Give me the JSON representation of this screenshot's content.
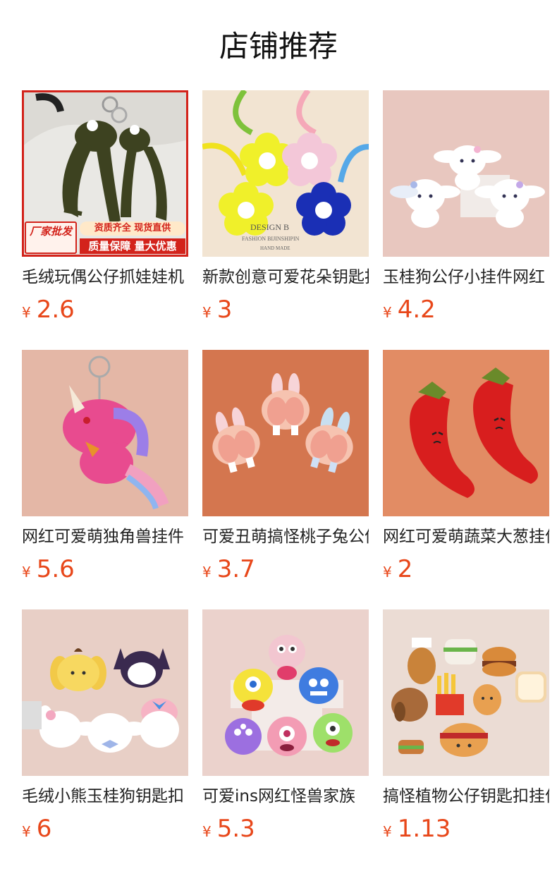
{
  "header": {
    "title": "店铺推荐"
  },
  "currency_symbol": "¥",
  "products": [
    {
      "name": "毛绒玩偶公仔抓娃娃机",
      "price": "2.6",
      "image": "frog-plush-keychain",
      "badge": {
        "left": "厂家批发",
        "top": "资质齐全 现货直供",
        "bottom": "质量保障 量大优惠"
      }
    },
    {
      "name": "新款创意可爱花朵钥匙扣",
      "price": "3",
      "image": "flower-keychain",
      "caption": [
        "DESIGN B",
        "FASHION BIJINSHIPIN",
        "HAND MADE"
      ]
    },
    {
      "name": "玉桂狗公仔小挂件网红",
      "price": "4.2",
      "image": "cinnamoroll-plush"
    },
    {
      "name": "网红可爱萌独角兽挂件",
      "price": "5.6",
      "image": "unicorn-plush"
    },
    {
      "name": "可爱丑萌搞怪桃子兔公仔",
      "price": "3.7",
      "image": "peach-bunny-plush"
    },
    {
      "name": "网红可爱萌蔬菜大葱挂件",
      "price": "2",
      "image": "chili-pepper-plush"
    },
    {
      "name": "毛绒小熊玉桂狗钥匙扣",
      "price": "6",
      "image": "sanrio-plush-set"
    },
    {
      "name": "可爱ins网红怪兽家族",
      "price": "5.3",
      "image": "monster-plush-set"
    },
    {
      "name": "搞怪植物公仔钥匙扣挂件",
      "price": "1.13",
      "image": "food-plush-set"
    }
  ]
}
